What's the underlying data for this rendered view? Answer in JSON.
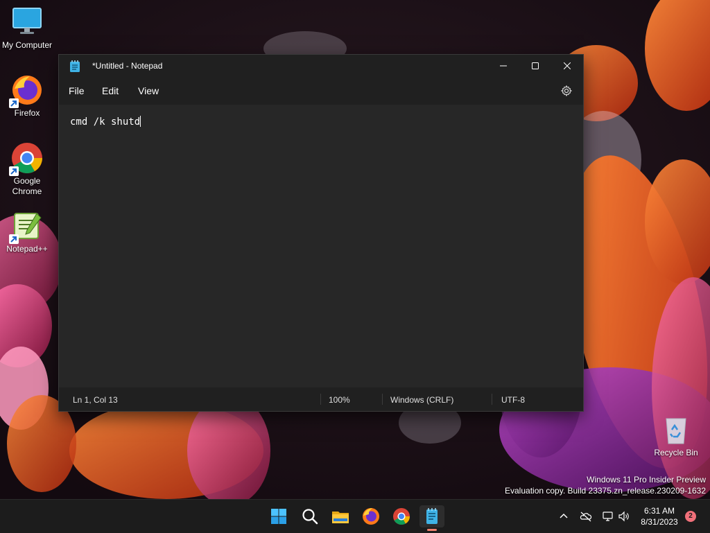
{
  "desktop": {
    "icons": [
      {
        "label": "My Computer",
        "icon": "monitor-icon"
      },
      {
        "label": "Firefox",
        "icon": "firefox-icon"
      },
      {
        "label": "Google Chrome",
        "icon": "chrome-icon"
      },
      {
        "label": "Notepad++",
        "icon": "notepadpp-icon"
      },
      {
        "label": "Recycle Bin",
        "icon": "recycle-bin-icon"
      }
    ],
    "watermark": {
      "line1": "Windows 11 Pro Insider Preview",
      "line2": "Evaluation copy. Build 23375.zn_release.230209-1632"
    }
  },
  "notepad": {
    "title": "*Untitled - Notepad",
    "menu": {
      "file": "File",
      "edit": "Edit",
      "view": "View"
    },
    "content": "cmd /k shutd",
    "status": {
      "position": "Ln 1, Col 13",
      "zoom": "100%",
      "line_ending": "Windows (CRLF)",
      "encoding": "UTF-8"
    }
  },
  "taskbar": {
    "apps": [
      "start-icon",
      "search-icon",
      "file-explorer-icon",
      "firefox-icon",
      "chrome-icon",
      "notepad-icon"
    ],
    "clock": {
      "time": "6:31 AM",
      "date": "8/31/2023"
    },
    "notification_count": "2"
  },
  "colors": {
    "window_bg": "#202020",
    "editor_bg": "#272727",
    "taskbar_bg": "#1c1c1c",
    "accent": "#f0816e"
  }
}
